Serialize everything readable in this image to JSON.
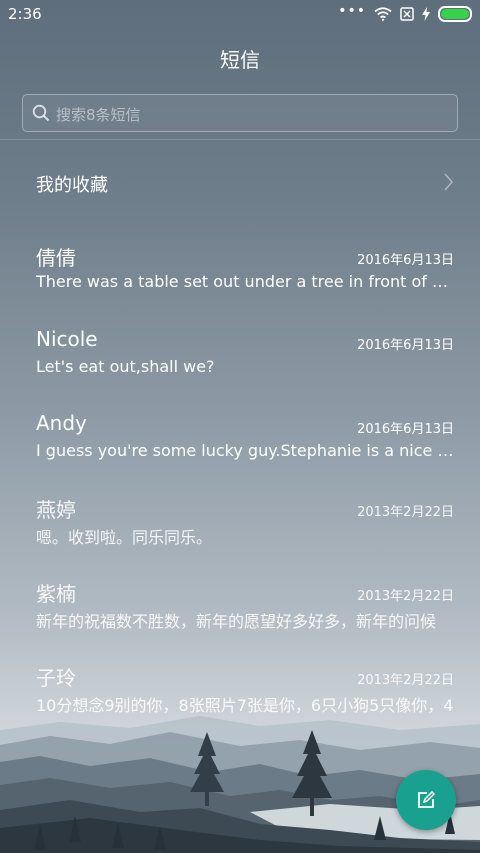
{
  "status_bar": {
    "time": "2:36",
    "icons": [
      "more-dots-icon",
      "wifi-icon",
      "no-sim-icon",
      "charging-icon",
      "battery-icon"
    ],
    "battery_color": "#36d24a"
  },
  "header": {
    "title": "短信"
  },
  "search": {
    "placeholder": "搜索8条短信"
  },
  "favorites": {
    "label": "我的收藏"
  },
  "threads": [
    {
      "name": "倩倩",
      "date": "2016年6月13日",
      "preview": "There was a table set out under a tree in front of the house"
    },
    {
      "name": "Nicole",
      "date": "2016年6月13日",
      "preview": "Let's eat out,shall we?"
    },
    {
      "name": "Andy",
      "date": "2016年6月13日",
      "preview": "I guess you're some lucky guy.Stephanie is a nice girl."
    },
    {
      "name": "燕婷",
      "date": "2013年2月22日",
      "preview": "嗯。收到啦。同乐同乐。"
    },
    {
      "name": "紫楠",
      "date": "2013年2月22日",
      "preview": "新年的祝福数不胜数，新年的愿望好多好多，新年的问候"
    },
    {
      "name": "子玲",
      "date": "2013年2月22日",
      "preview": "10分想念9别的你，8张照片7张是你，6只小狗5只像你，4"
    }
  ],
  "fab": {
    "icon": "compose-icon",
    "color": "#1aa08f"
  }
}
